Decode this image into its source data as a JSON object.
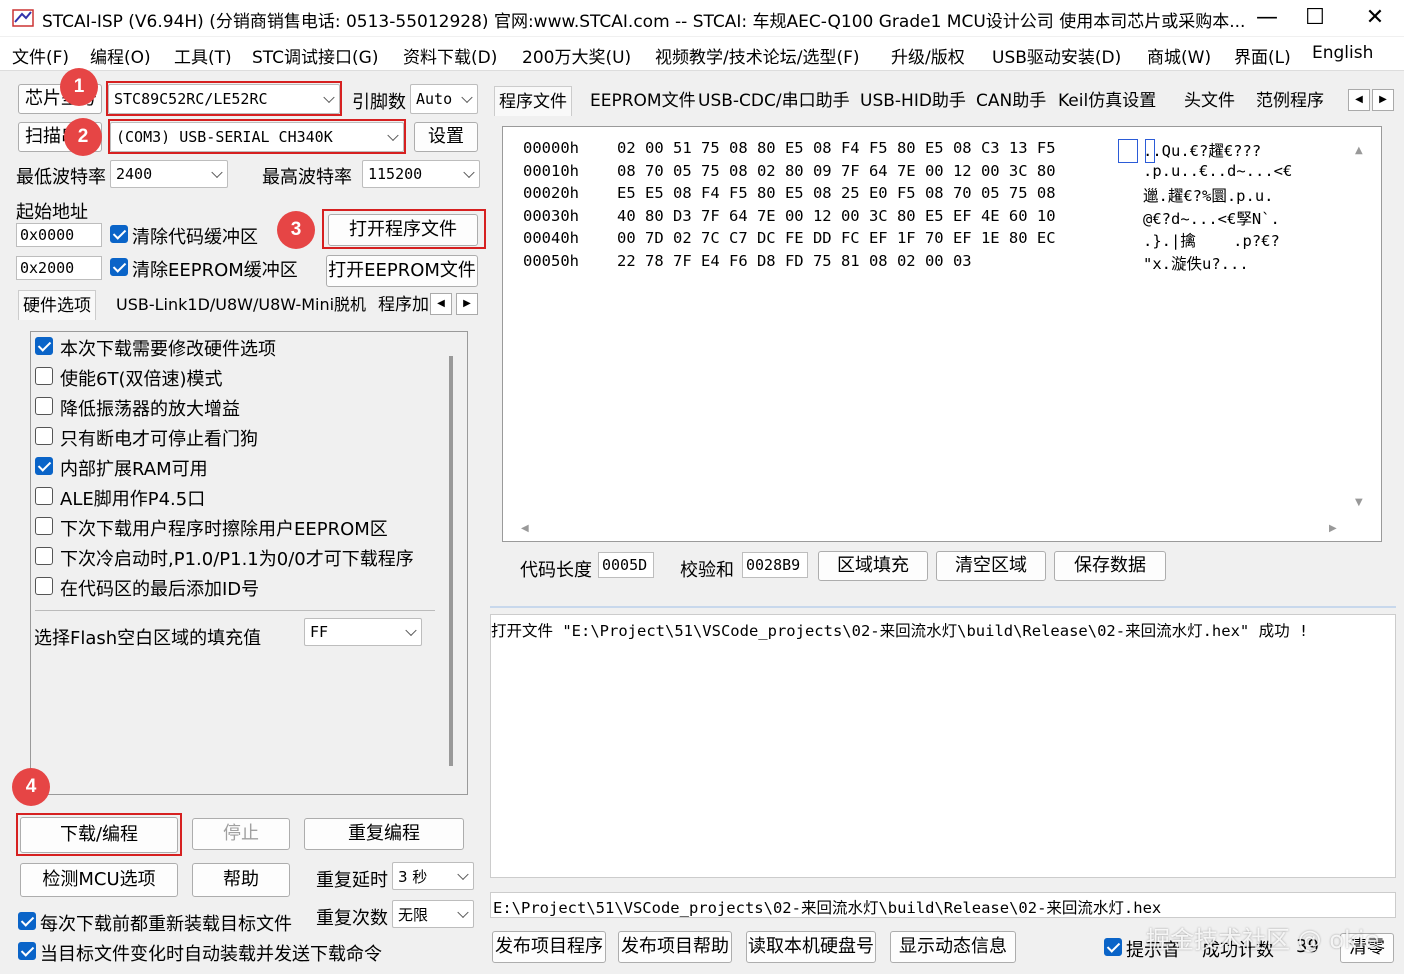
{
  "window": {
    "title": "STCAI-ISP (V6.94H) (分销商销售电话: 0513-55012928) 官网:www.STCAI.com  -- STCAI: 车规AEC-Q100 Grade1 MCU设计公司 使用本司芯片或采购本...",
    "minimize": "—",
    "maximize": "☐",
    "close": "✕"
  },
  "menu": [
    "文件(F)",
    "编程(O)",
    "工具(T)",
    "STC调试接口(G)",
    "资料下载(D)",
    "200万大奖(U)",
    "视频教学/技术论坛/选型(F)",
    "升级/版权",
    "USB驱动安装(D)",
    "商城(W)",
    "界面(L)",
    "English"
  ],
  "left": {
    "chip_label": "芯片型号",
    "chip_value": "STC89C52RC/LE52RC",
    "pins_label": "引脚数",
    "pins_value": "Auto",
    "scan_label": "扫描串口",
    "port_value": "(COM3) USB-SERIAL CH340K",
    "settings_btn": "设置",
    "min_baud_label": "最低波特率",
    "min_baud_value": "2400",
    "max_baud_label": "最高波特率",
    "max_baud_value": "115200",
    "start_addr_label": "起始地址",
    "addr1": "0x0000",
    "clear_code_label": "清除代码缓冲区",
    "open_prog_btn": "打开程序文件",
    "addr2": "0x2000",
    "clear_eeprom_label": "清除EEPROM缓冲区",
    "open_eeprom_btn": "打开EEPROM文件",
    "tabs": [
      "硬件选项",
      "USB-Link1D/U8W/U8W-Mini脱机",
      "程序加"
    ],
    "options": [
      {
        "label": "本次下载需要修改硬件选项",
        "checked": true
      },
      {
        "label": "使能6T(双倍速)模式",
        "checked": false
      },
      {
        "label": "降低振荡器的放大增益",
        "checked": false
      },
      {
        "label": "只有断电才可停止看门狗",
        "checked": false
      },
      {
        "label": "内部扩展RAM可用",
        "checked": true
      },
      {
        "label": "ALE脚用作P4.5口",
        "checked": false
      },
      {
        "label": "下次下载用户程序时擦除用户EEPROM区",
        "checked": false
      },
      {
        "label": "下次冷启动时,P1.0/P1.1为0/0才可下载程序",
        "checked": false
      },
      {
        "label": "在代码区的最后添加ID号",
        "checked": false
      }
    ],
    "fill_label": "选择Flash空白区域的填充值",
    "fill_value": "FF",
    "download_btn": "下载/编程",
    "stop_btn": "停止",
    "repeat_btn": "重复编程",
    "check_mcu_btn": "检测MCU选项",
    "help_btn": "帮助",
    "delay_label": "重复延时",
    "delay_value": "3 秒",
    "count_label": "重复次数",
    "count_value": "无限",
    "reload_label": "每次下载前都重新装载目标文件",
    "auto_label": "当目标文件变化时自动装载并发送下载命令"
  },
  "badges": [
    "1",
    "2",
    "3",
    "4"
  ],
  "right": {
    "tabs": [
      "程序文件",
      "EEPROM文件",
      "USB-CDC/串口助手",
      "USB-HID助手",
      "CAN助手",
      "Keil仿真设置",
      "头文件",
      "范例程序"
    ],
    "hex_rows": [
      {
        "addr": "00000h",
        "bytes": "02 00 51 75 08 80 E5 08 F4 F5 80 E5 08 C3 13 F5",
        "ascii": "..Qu.€?趯€???"
      },
      {
        "addr": "00010h",
        "bytes": "08 70 05 75 08 02 80 09 7F 64 7E 00 12 00 3C 80",
        "ascii": ".p.u..€..d~...<€"
      },
      {
        "addr": "00020h",
        "bytes": "E5 E5 08 F4 F5 80 E5 08 25 E0 F5 08 70 05 75 08",
        "ascii": "邋.趯€?%圜.p.u."
      },
      {
        "addr": "00030h",
        "bytes": "40 80 D3 7F 64 7E 00 12 00 3C 80 E5 EF 4E 60 10",
        "ascii": "@€?d~...<€孯N`."
      },
      {
        "addr": "00040h",
        "bytes": "00 7D 02 7C C7 DC FE DD FC EF 1F 70 EF 1E 80 EC",
        "ascii": ".}.|擒    .p?€?"
      },
      {
        "addr": "00050h",
        "bytes": "22 78 7F E4 F6 D8 FD 75 81 08 02 00 03",
        "ascii": "\"x.漩佚u?..."
      }
    ],
    "code_len_label": "代码长度",
    "code_len_value": "0005D",
    "checksum_label": "校验和",
    "checksum_value": "0028B9",
    "fill_area_btn": "区域填充",
    "clear_area_btn": "清空区域",
    "save_data_btn": "保存数据",
    "log_text": "打开文件 \"E:\\Project\\51\\VSCode_projects\\02-来回流水灯\\build\\Release\\02-来回流水灯.hex\" 成功 !",
    "path_text": "E:\\Project\\51\\VSCode_projects\\02-来回流水灯\\build\\Release\\02-来回流水灯.hex",
    "publish_prog_btn": "发布项目程序",
    "publish_help_btn": "发布项目帮助",
    "read_disk_btn": "读取本机硬盘号",
    "show_info_btn": "显示动态信息",
    "hint_label": "提示音",
    "success_label": "成功计数",
    "success_count": "39",
    "clear_btn": "清零"
  },
  "watermark": "掘金技术社区 @ okie"
}
